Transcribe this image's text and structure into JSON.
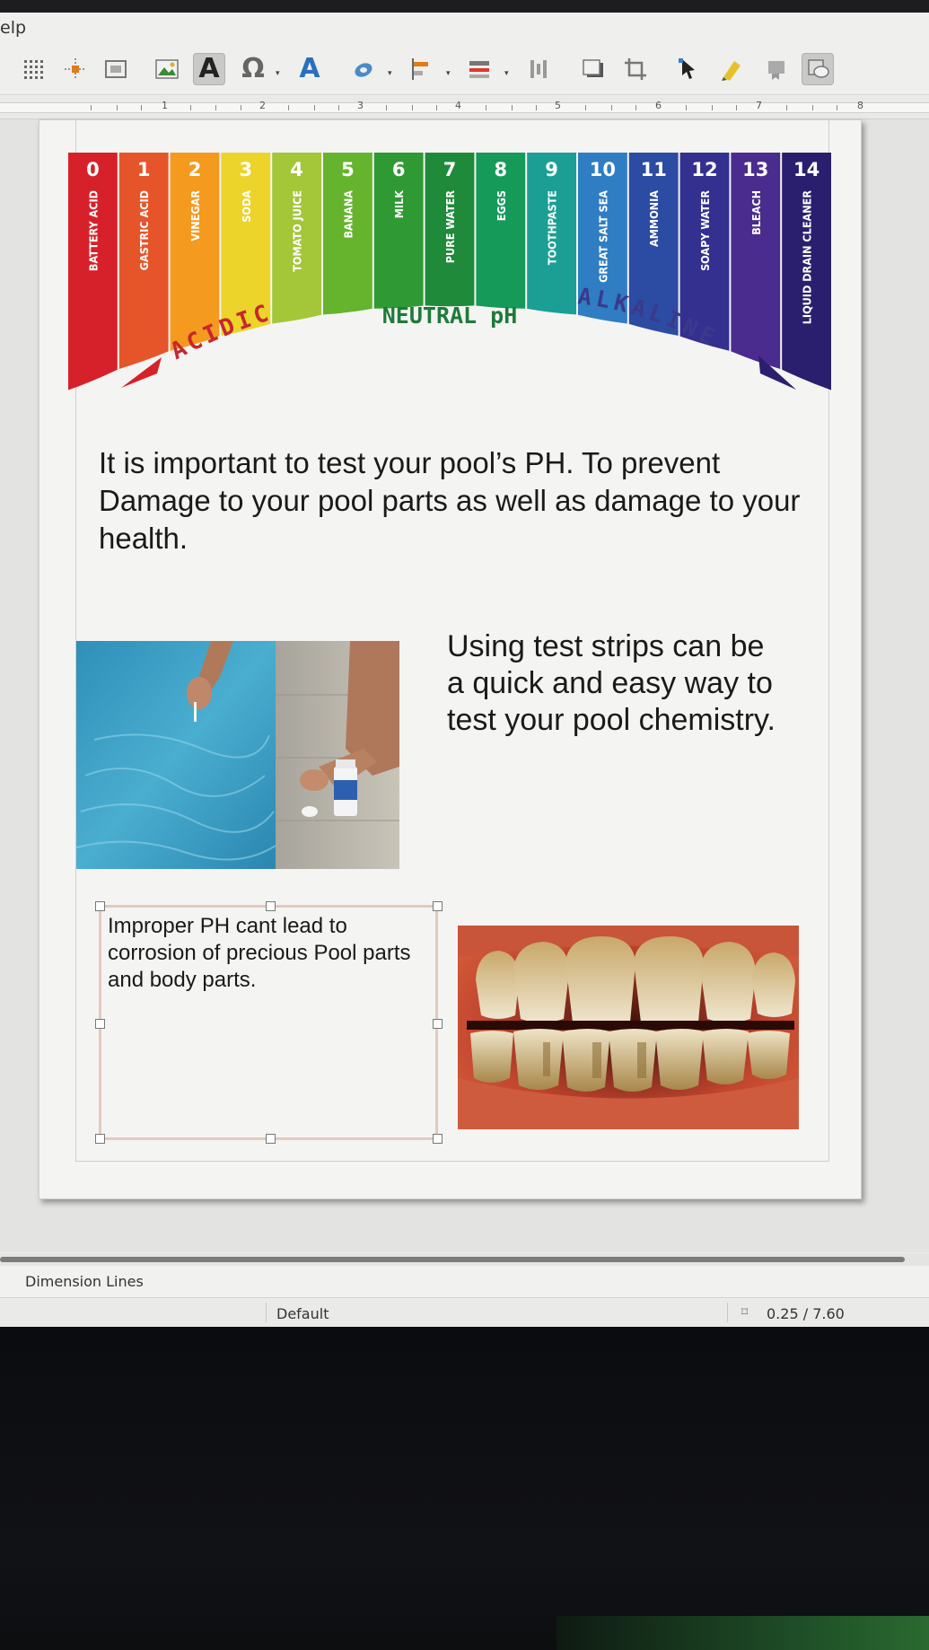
{
  "app": {
    "menu_partial": "elp"
  },
  "ruler": {
    "numbers": [
      "1",
      "2",
      "3",
      "4",
      "5",
      "6",
      "7",
      "8"
    ]
  },
  "ph_chart": {
    "scale": [
      {
        "value": "0",
        "label": "BATTERY ACID",
        "color": "#d6212b"
      },
      {
        "value": "1",
        "label": "GASTRIC ACID",
        "color": "#e6552a"
      },
      {
        "value": "2",
        "label": "VINEGAR",
        "color": "#f39a1f"
      },
      {
        "value": "3",
        "label": "SODA",
        "color": "#ecd42b"
      },
      {
        "value": "4",
        "label": "TOMATO JUICE",
        "color": "#a4c639"
      },
      {
        "value": "5",
        "label": "BANANA",
        "color": "#66b32e"
      },
      {
        "value": "6",
        "label": "MILK",
        "color": "#2f9a34"
      },
      {
        "value": "7",
        "label": "PURE WATER",
        "color": "#1f8a3a"
      },
      {
        "value": "8",
        "label": "EGGS",
        "color": "#159a5a"
      },
      {
        "value": "9",
        "label": "TOOTHPASTE",
        "color": "#1b9f94"
      },
      {
        "value": "10",
        "label": "GREAT SALT SEA",
        "color": "#2f7dc3"
      },
      {
        "value": "11",
        "label": "AMMONIA",
        "color": "#2c4ba2"
      },
      {
        "value": "12",
        "label": "SOAPY WATER",
        "color": "#34308f"
      },
      {
        "value": "13",
        "label": "BLEACH",
        "color": "#4a2c8e"
      },
      {
        "value": "14",
        "label": "LIQUID DRAIN CLEANER",
        "color": "#2a1f6e"
      }
    ],
    "acidic_label": "ACIDIC",
    "neutral_label": "NEUTRAL pH",
    "alkaline_label": "ALKALINE"
  },
  "document": {
    "paragraph_1": "It is important to test your pool’s PH. To prevent Damage to your pool parts as well as damage to your health.",
    "paragraph_2": "Using test strips can be a quick and easy way to test your pool chemistry.",
    "paragraph_3": "Improper PH cant lead to corrosion of precious Pool parts and body parts."
  },
  "sheet_tab": "Dimension Lines",
  "status": {
    "layout": "Default",
    "position": "0.25 / 7.60"
  }
}
